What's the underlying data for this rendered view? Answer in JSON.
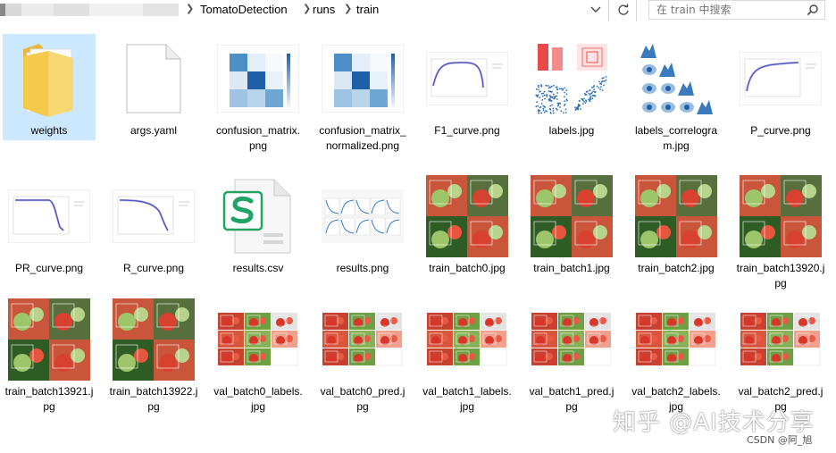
{
  "address_bar": {
    "path": [
      "TomatoDetection",
      "runs",
      "train"
    ],
    "search_placeholder": "在 train 中搜索"
  },
  "files": [
    {
      "name": "weights",
      "kind": "folder",
      "selected": true
    },
    {
      "name": "args.yaml",
      "kind": "blank-file"
    },
    {
      "name": "confusion_matrix.png",
      "kind": "confusion-matrix"
    },
    {
      "name": "confusion_matrix_normalized.png",
      "kind": "confusion-matrix"
    },
    {
      "name": "F1_curve.png",
      "kind": "curve-f1"
    },
    {
      "name": "labels.jpg",
      "kind": "labels"
    },
    {
      "name": "labels_correlogram.jpg",
      "kind": "correlogram"
    },
    {
      "name": "P_curve.png",
      "kind": "curve-p"
    },
    {
      "name": "PR_curve.png",
      "kind": "curve-pr"
    },
    {
      "name": "R_curve.png",
      "kind": "curve-r"
    },
    {
      "name": "results.csv",
      "kind": "csv"
    },
    {
      "name": "results.png",
      "kind": "results"
    },
    {
      "name": "train_batch0.jpg",
      "kind": "photo-batch"
    },
    {
      "name": "train_batch1.jpg",
      "kind": "photo-batch"
    },
    {
      "name": "train_batch2.jpg",
      "kind": "photo-batch"
    },
    {
      "name": "train_batch13920.jpg",
      "kind": "photo-batch"
    },
    {
      "name": "train_batch13921.jpg",
      "kind": "photo-batch"
    },
    {
      "name": "train_batch13922.jpg",
      "kind": "photo-batch"
    },
    {
      "name": "val_batch0_labels.jpg",
      "kind": "val-batch"
    },
    {
      "name": "val_batch0_pred.jpg",
      "kind": "val-batch"
    },
    {
      "name": "val_batch1_labels.jpg",
      "kind": "val-batch"
    },
    {
      "name": "val_batch1_pred.jpg",
      "kind": "val-batch"
    },
    {
      "name": "val_batch2_labels.jpg",
      "kind": "val-batch"
    },
    {
      "name": "val_batch2_pred.jpg",
      "kind": "val-batch"
    }
  ],
  "watermark": {
    "zhihu": "知乎 @AI技术分享",
    "csdn": "CSDN @阿_旭"
  },
  "colors": {
    "selection": "#cce8ff",
    "folder": "#f5c94a",
    "csv_green": "#21a366",
    "matrix_blue": "#1f5fa8"
  }
}
